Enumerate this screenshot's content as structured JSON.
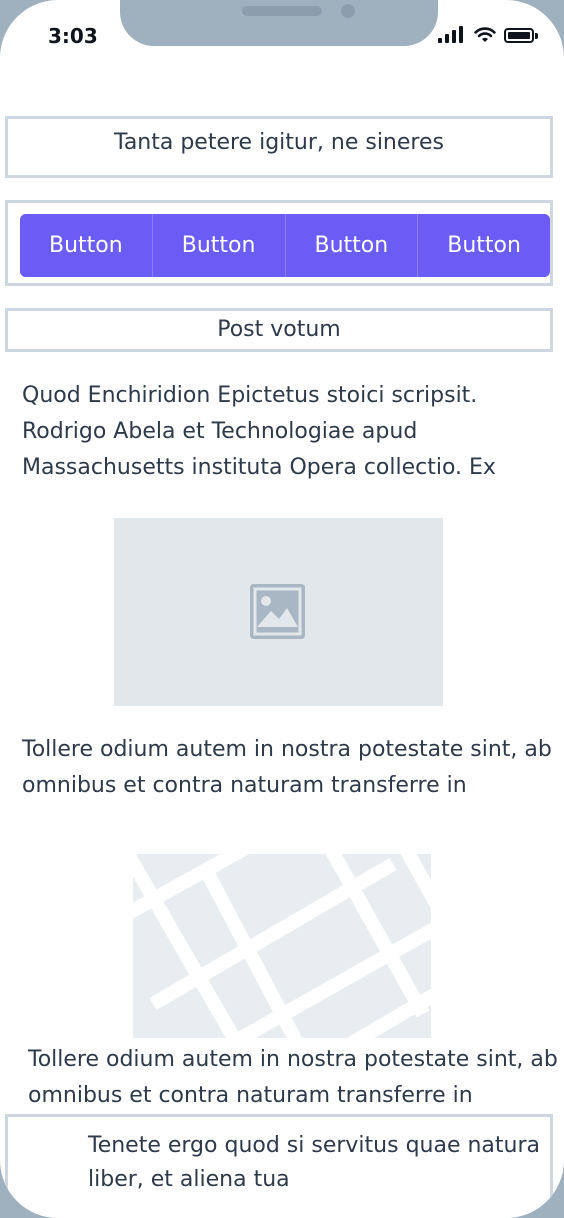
{
  "status_bar": {
    "time": "3:03",
    "icons": [
      "signal-icon",
      "wifi-icon",
      "battery-icon"
    ]
  },
  "header": {
    "title": "Tanta petere igitur, ne sineres"
  },
  "button_group": {
    "buttons": [
      "Button",
      "Button",
      "Button",
      "Button"
    ],
    "color": "#6b5cf6"
  },
  "subheader": {
    "text": "Post votum"
  },
  "content": {
    "paragraph_1": "Quod Enchiridion Epictetus stoici scripsit. Rodrigo Abela et Technologiae apud Massachusetts instituta Opera collectio. Ex",
    "image_icon": "image-icon",
    "paragraph_2": "Tollere odium autem in nostra potestate sint, ab omnibus et contra naturam transferre in",
    "map_icon": "map-placeholder",
    "paragraph_3": "Tollere odium autem in nostra potestate sint, ab omnibus et contra naturam transferre in"
  },
  "footer": {
    "text": "Tenete ergo quod si servitus quae natura liber, et aliena tua"
  }
}
